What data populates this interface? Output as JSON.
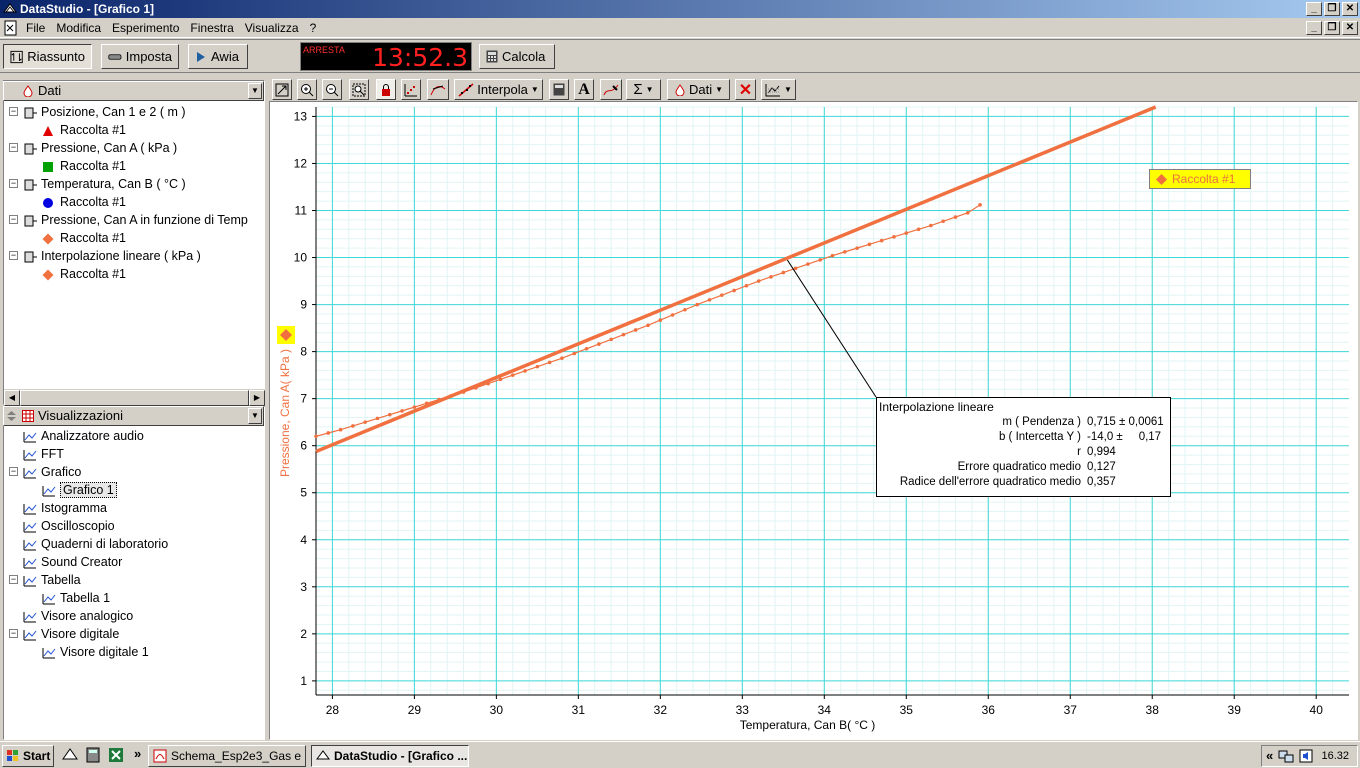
{
  "window": {
    "title": "DataStudio - [Grafico 1]"
  },
  "menu": [
    "File",
    "Modifica",
    "Esperimento",
    "Finestra",
    "Visualizza",
    "?"
  ],
  "toolbar": {
    "summary": "Riassunto",
    "setup": "Imposta",
    "start": "Awia",
    "calc": "Calcola",
    "clock_status": "ARRESTA",
    "clock_time": "13:52.3"
  },
  "data_panel": {
    "title": "Dati",
    "items": [
      {
        "label": "Posizione, Can 1 e 2 ( m )",
        "child": "Raccolta #1",
        "marker": "triangle",
        "color": "#e00000"
      },
      {
        "label": "Pressione, Can A ( kPa )",
        "child": "Raccolta #1",
        "marker": "square",
        "color": "#00a000"
      },
      {
        "label": "Temperatura, Can B ( °C )",
        "child": "Raccolta #1",
        "marker": "circle",
        "color": "#0000e0"
      },
      {
        "label": "Pressione, Can A in funzione di Temp",
        "child": "Raccolta #1",
        "marker": "diamond",
        "color": "#f07040"
      },
      {
        "label": "Interpolazione lineare ( kPa )",
        "child": "Raccolta #1",
        "marker": "diamond",
        "color": "#f07040"
      }
    ]
  },
  "views_panel": {
    "title": "Visualizzazioni",
    "items": [
      {
        "label": "Analizzatore audio",
        "level": 0,
        "expand": ""
      },
      {
        "label": "FFT",
        "level": 0,
        "expand": ""
      },
      {
        "label": "Grafico",
        "level": 0,
        "expand": "-"
      },
      {
        "label": "Grafico 1",
        "level": 1,
        "expand": "",
        "selected": true
      },
      {
        "label": "Istogramma",
        "level": 0,
        "expand": ""
      },
      {
        "label": "Oscilloscopio",
        "level": 0,
        "expand": ""
      },
      {
        "label": "Quaderni di laboratorio",
        "level": 0,
        "expand": ""
      },
      {
        "label": "Sound Creator",
        "level": 0,
        "expand": ""
      },
      {
        "label": "Tabella",
        "level": 0,
        "expand": "-"
      },
      {
        "label": "Tabella 1",
        "level": 1,
        "expand": ""
      },
      {
        "label": "Visore analogico",
        "level": 0,
        "expand": ""
      },
      {
        "label": "Visore digitale",
        "level": 0,
        "expand": "-"
      },
      {
        "label": "Visore digitale 1",
        "level": 1,
        "expand": ""
      }
    ]
  },
  "graph_toolbar": {
    "fit_label": "Interpola",
    "data_label": "Dati"
  },
  "chart_data": {
    "type": "scatter",
    "xlabel": "Temperatura, Can B( °C )",
    "ylabel": "Pressione, Can A( kPa )",
    "xlim": [
      27.8,
      40.4
    ],
    "ylim": [
      0.7,
      13.2
    ],
    "xticks": [
      28,
      29,
      30,
      31,
      32,
      33,
      34,
      35,
      36,
      37,
      38,
      39,
      40
    ],
    "yticks": [
      1,
      2,
      3,
      4,
      5,
      6,
      7,
      8,
      9,
      10,
      11,
      12,
      13
    ],
    "grid": true,
    "legend": "Raccolta #1",
    "series_color": "#f07040",
    "fit_line": {
      "slope": 0.715,
      "intercept": -14.0
    },
    "points": [
      [
        27.8,
        6.2
      ],
      [
        27.95,
        6.27
      ],
      [
        28.1,
        6.34
      ],
      [
        28.25,
        6.42
      ],
      [
        28.4,
        6.5
      ],
      [
        28.55,
        6.58
      ],
      [
        28.7,
        6.66
      ],
      [
        28.85,
        6.74
      ],
      [
        29.0,
        6.82
      ],
      [
        29.15,
        6.9
      ],
      [
        29.3,
        6.98
      ],
      [
        29.45,
        7.06
      ],
      [
        29.6,
        7.14
      ],
      [
        29.75,
        7.23
      ],
      [
        29.9,
        7.32
      ],
      [
        30.05,
        7.41
      ],
      [
        30.2,
        7.5
      ],
      [
        30.35,
        7.59
      ],
      [
        30.5,
        7.68
      ],
      [
        30.65,
        7.77
      ],
      [
        30.8,
        7.86
      ],
      [
        30.95,
        7.96
      ],
      [
        31.1,
        8.06
      ],
      [
        31.25,
        8.16
      ],
      [
        31.4,
        8.26
      ],
      [
        31.55,
        8.36
      ],
      [
        31.7,
        8.46
      ],
      [
        31.85,
        8.56
      ],
      [
        32.0,
        8.67
      ],
      [
        32.15,
        8.78
      ],
      [
        32.3,
        8.89
      ],
      [
        32.45,
        9.0
      ],
      [
        32.6,
        9.1
      ],
      [
        32.75,
        9.2
      ],
      [
        32.9,
        9.3
      ],
      [
        33.05,
        9.4
      ],
      [
        33.2,
        9.5
      ],
      [
        33.35,
        9.59
      ],
      [
        33.5,
        9.68
      ],
      [
        33.65,
        9.77
      ],
      [
        33.8,
        9.86
      ],
      [
        33.95,
        9.95
      ],
      [
        34.1,
        10.04
      ],
      [
        34.25,
        10.12
      ],
      [
        34.4,
        10.2
      ],
      [
        34.55,
        10.28
      ],
      [
        34.7,
        10.36
      ],
      [
        34.85,
        10.44
      ],
      [
        35.0,
        10.52
      ],
      [
        35.15,
        10.6
      ],
      [
        35.3,
        10.68
      ],
      [
        35.45,
        10.77
      ],
      [
        35.6,
        10.86
      ],
      [
        35.75,
        10.95
      ],
      [
        35.9,
        11.12
      ]
    ],
    "fit_box": {
      "title": "Interpolazione lineare",
      "rows": [
        {
          "label": "m ( Pendenza )",
          "value": "0,715 ± 0,0061"
        },
        {
          "label": "b ( Intercetta Y )",
          "value": "-14,0 ±     0,17"
        },
        {
          "label": "r",
          "value": "0,994"
        },
        {
          "label": "Errore quadratico medio",
          "value": "0,127"
        },
        {
          "label": "Radice dell'errore quadratico medio",
          "value": "0,357"
        }
      ]
    }
  },
  "taskbar": {
    "start": "Start",
    "tasks": [
      "Schema_Esp2e3_Gas e ...",
      "DataStudio - [Grafico ..."
    ],
    "chevron": "»",
    "tray_chevron": "«",
    "clock": "16.32"
  }
}
